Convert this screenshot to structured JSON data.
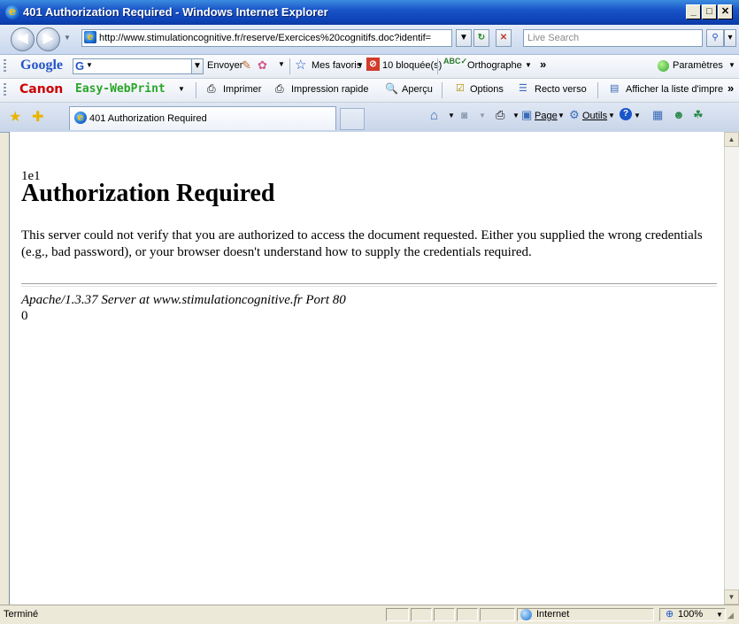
{
  "window": {
    "title": "401 Authorization Required - Windows Internet Explorer",
    "controls": {
      "minimize": "_",
      "maximize": "□",
      "close": "✕"
    }
  },
  "address_bar": {
    "url": "http://www.stimulationcognitive.fr/reserve/Exercices%20cognitifs.doc?identif=",
    "search_placeholder": "Live Search"
  },
  "google_toolbar": {
    "logo": "Google",
    "g_button": "G",
    "send": "Envoyer",
    "bookmarks": "Mes favoris",
    "blocked": "10 bloquée(s)",
    "spell": "Orthographe",
    "more": "»",
    "settings": "Paramètres"
  },
  "canon_toolbar": {
    "brand": "Canon",
    "product": "Easy-WebPrint",
    "print": "Imprimer",
    "quick_print": "Impression rapide",
    "preview": "Aperçu",
    "options": "Options",
    "duplex": "Recto verso",
    "print_list": "Afficher la liste d'impre",
    "more": "»"
  },
  "tabs": {
    "active_tab": "401 Authorization Required"
  },
  "command_bar": {
    "page": "Page",
    "tools": "Outils"
  },
  "page": {
    "chunk_prefix": "1e1",
    "heading": "Authorization Required",
    "body": "This server could not verify that you are authorized to access the document requested. Either you supplied the wrong credentials (e.g., bad password), or your browser doesn't understand how to supply the credentials required.",
    "address": "Apache/1.3.37 Server at www.stimulationcognitive.fr Port 80",
    "chunk_suffix": "0"
  },
  "status_bar": {
    "status": "Terminé",
    "zone": "Internet",
    "zoom": "100%"
  }
}
